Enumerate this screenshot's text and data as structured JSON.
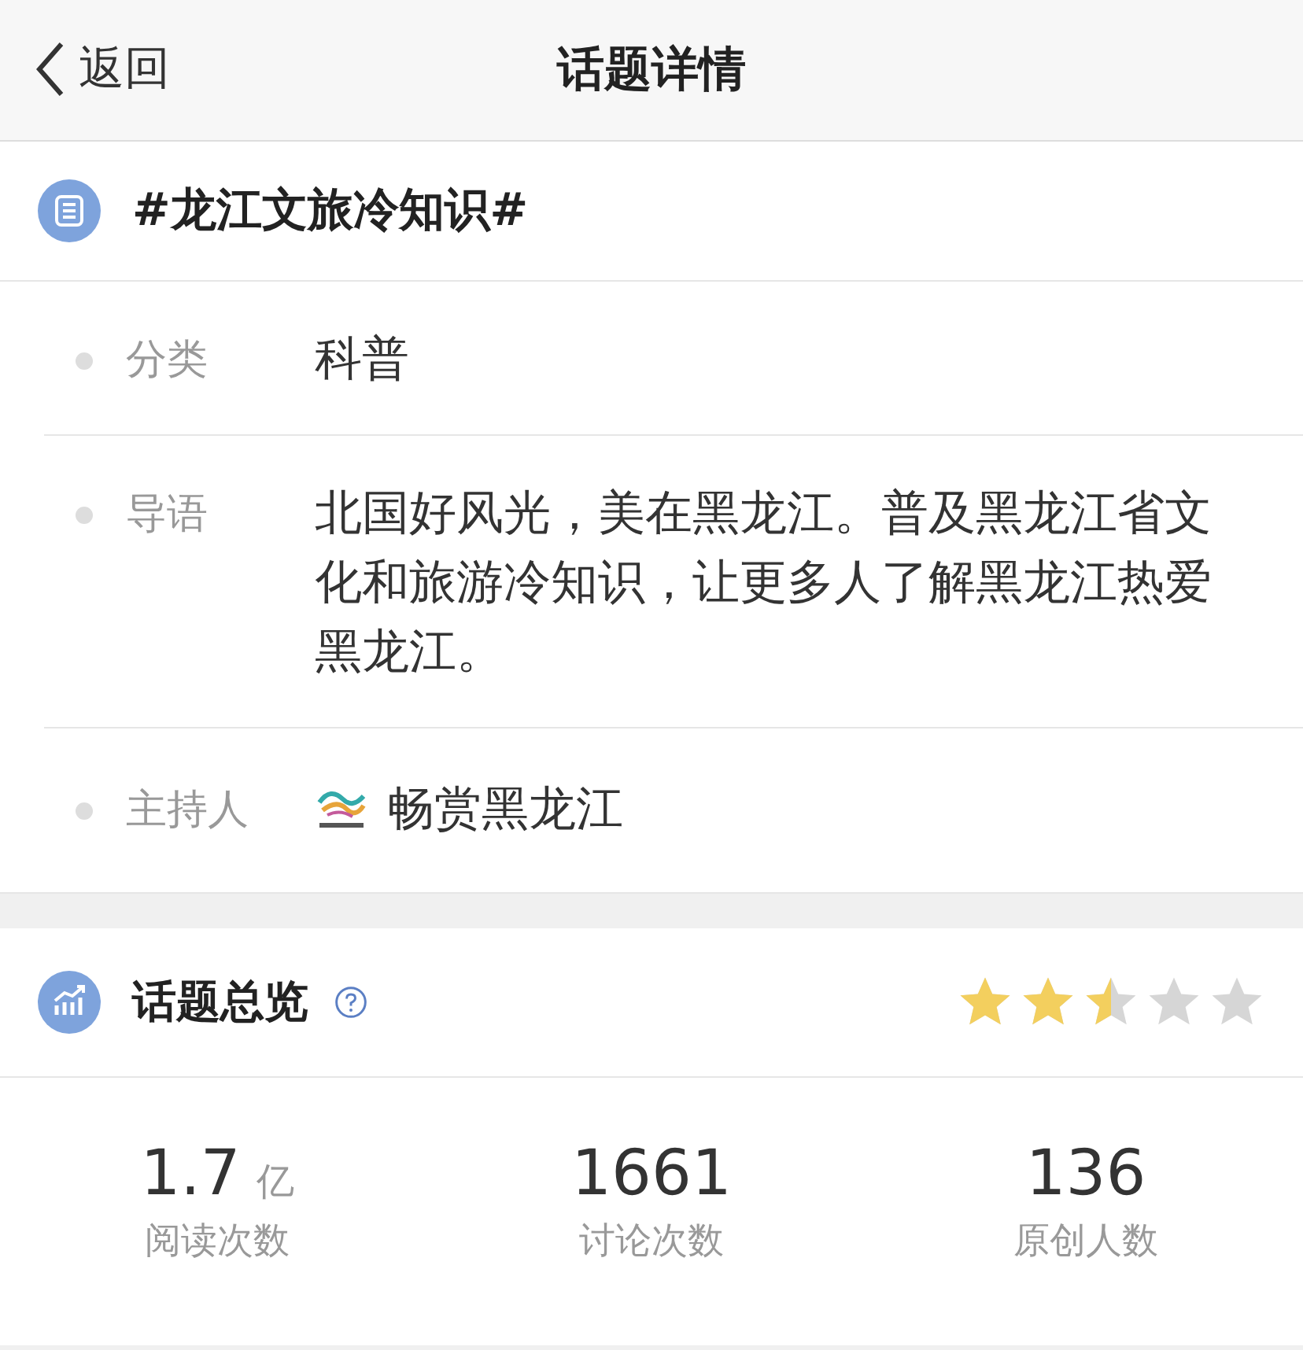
{
  "nav": {
    "back": "返回",
    "title": "话题详情"
  },
  "topic": {
    "title": "#龙江文旅冷知识#"
  },
  "info": [
    {
      "kind": "text",
      "label": "分类",
      "value": "科普"
    },
    {
      "kind": "text",
      "label": "导语",
      "value": "北国好风光，美在黑龙江。普及黑龙江省文化和旅游冷知识，让更多人了解黑龙江热爱黑龙江。"
    },
    {
      "kind": "host",
      "label": "主持人",
      "value": "畅赏黑龙江"
    }
  ],
  "overview": {
    "title": "话题总览",
    "stars": 2.5
  },
  "stats": [
    {
      "value": "1.7",
      "unit": "亿",
      "label": "阅读次数"
    },
    {
      "value": "1661",
      "label": "讨论次数"
    },
    {
      "value": "136",
      "label": "原创人数"
    }
  ]
}
